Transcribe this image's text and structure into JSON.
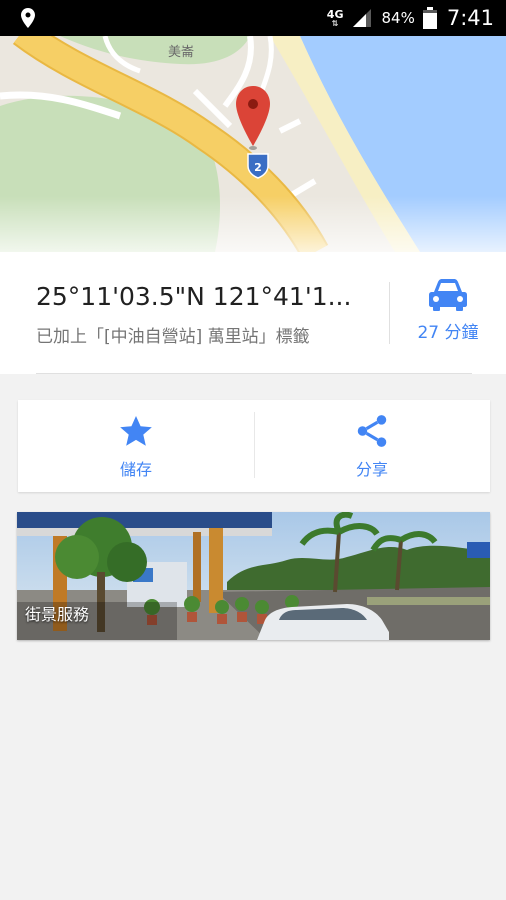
{
  "status_bar": {
    "network": "4G",
    "battery_percent": "84%",
    "time": "7:41"
  },
  "map": {
    "place_label": "美崙",
    "route_shield": "2"
  },
  "place": {
    "coordinates": "25°11'03.5\"N 121°41'1...",
    "tag_text": "已加上「[中油自營站] 萬里站」標籤"
  },
  "directions": {
    "duration": "27 分鐘"
  },
  "actions": {
    "save_label": "儲存",
    "share_label": "分享"
  },
  "street_view": {
    "label": "街景服務"
  },
  "colors": {
    "accent": "#4285f4",
    "marker": "#db4437",
    "road": "#f6cf65",
    "water": "#a3ccff"
  }
}
